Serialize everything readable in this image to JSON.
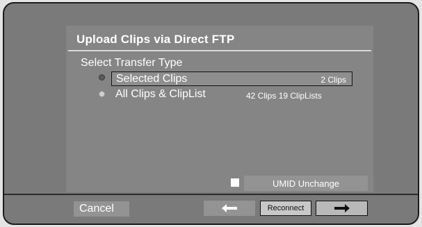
{
  "dialog": {
    "title": "Upload Clips via Direct FTP",
    "section_label": "Select Transfer Type",
    "options": [
      {
        "label": "Selected Clips",
        "count": "2 Clips",
        "selected": true
      },
      {
        "label": "All Clips & ClipList",
        "count": "42 Clips 19 ClipLists",
        "selected": false
      }
    ],
    "umid_label": "UMID Unchange",
    "umid_checked": false
  },
  "footer": {
    "cancel_label": "Cancel",
    "prev_icon": "arrow-left-icon",
    "reconnect_label": "Reconnect",
    "next_icon": "arrow-right-icon"
  },
  "colors": {
    "screen_bg": "#7a7a7a",
    "panel_bg": "#858585",
    "button_bg": "#939393",
    "text": "#ffffff"
  }
}
